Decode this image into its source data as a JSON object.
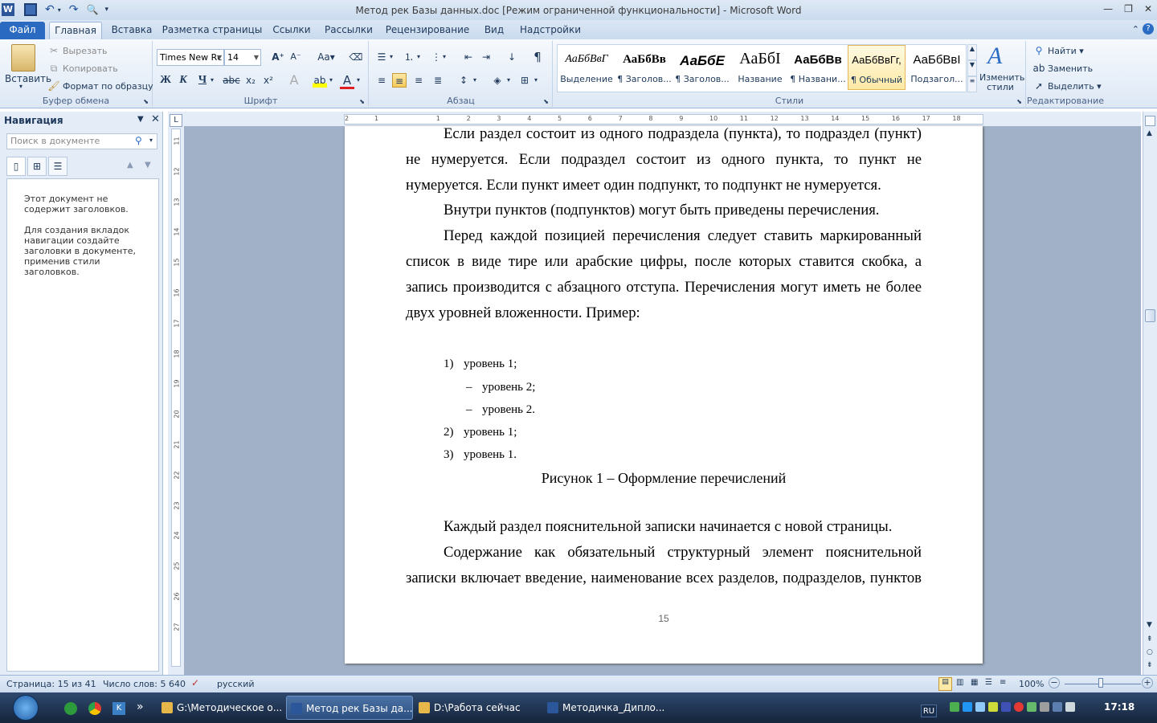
{
  "window": {
    "title": "Метод рек Базы данных.doc [Режим ограниченной функциональности]  -  Microsoft Word",
    "min": "—",
    "max": "❐",
    "close": "✕"
  },
  "tabs": [
    "Файл",
    "Главная",
    "Вставка",
    "Разметка страницы",
    "Ссылки",
    "Рассылки",
    "Рецензирование",
    "Вид",
    "Надстройки"
  ],
  "clipboard": {
    "paste": "Вставить",
    "cut": "Вырезать",
    "copy": "Копировать",
    "format_painter": "Формат по образцу",
    "label": "Буфер обмена"
  },
  "font": {
    "name": "Times New Rc",
    "size": "14",
    "label": "Шрифт",
    "case_btn": "Aa"
  },
  "paragraph": {
    "label": "Абзац"
  },
  "styles": {
    "label": "Стили",
    "items": [
      {
        "sample": "АаБбВвГ",
        "name": "Выделение"
      },
      {
        "sample": "АаБбВв",
        "name": "¶ Заголов..."
      },
      {
        "sample": "АаБбЕ",
        "name": "¶ Заголов..."
      },
      {
        "sample": "АаБбI",
        "name": "Название"
      },
      {
        "sample": "АаБбВв",
        "name": "¶ Названи..."
      },
      {
        "sample": "АаБбВвГг,",
        "name": "¶ Обычный"
      },
      {
        "sample": "АаБбВвI",
        "name": "Подзагол..."
      }
    ],
    "change": "Изменить стили"
  },
  "editing": {
    "find": "Найти",
    "replace": "Заменить",
    "select": "Выделить",
    "label": "Редактирование"
  },
  "nav": {
    "title": "Навигация",
    "search_placeholder": "Поиск в документе",
    "msg1": "Этот документ не содержит заголовков.",
    "msg2": "Для создания вкладок навигации создайте заголовки в документе, применив стили заголовков."
  },
  "ruler_numbers": [
    "2",
    "1",
    "1",
    "2",
    "3",
    "4",
    "5",
    "6",
    "7",
    "8",
    "9",
    "10",
    "11",
    "12",
    "13",
    "14",
    "15",
    "16",
    "17",
    "18"
  ],
  "vruler_numbers": [
    "11",
    "12",
    "13",
    "14",
    "15",
    "16",
    "17",
    "18",
    "19",
    "20",
    "21",
    "22",
    "23",
    "24",
    "25",
    "26",
    "27"
  ],
  "document": {
    "p1": "Если раздел состоит из одного подраздела (пункта), то подраздел (пункт) не нумеруется. Если подраздел состоит из одного пункта, то пункт не нумеруется. Если пункт имеет один подпункт, то подпункт не нумеруется.",
    "p2": "Внутри пунктов (подпунктов) могут быть приведены перечисления.",
    "p3": "Перед каждой позицией перечисления следует ставить маркированный список в виде  тире или арабские цифры, после которых ставится скобка, а запись производится с абзацного отступа. Перечисления могут иметь не более двух уровней вложенности. Пример:",
    "list": [
      {
        "marker": "1)",
        "text": "уровень 1;"
      },
      {
        "marker": "–",
        "text": "уровень 2;"
      },
      {
        "marker": "–",
        "text": "уровень 2."
      },
      {
        "marker": "2)",
        "text": "уровень 1;"
      },
      {
        "marker": "3)",
        "text": "уровень 1."
      }
    ],
    "caption": "Рисунок 1 – Оформление перечислений",
    "p4": "Каждый раздел пояснительной записки начинается с новой страницы.",
    "p5": "Содержание как обязательный структурный элемент пояснительной записки включает введение, наименование всех разделов, подразделов, пунктов (если они",
    "page_number": "15"
  },
  "status": {
    "page": "Страница: 15 из 41",
    "words": "Число слов: 5 640",
    "lang": "русский",
    "zoom": "100%"
  },
  "taskbar": {
    "items": [
      {
        "label": "G:\\Методическое о..."
      },
      {
        "label": "Метод рек Базы да..."
      },
      {
        "label": "D:\\Работа сейчас"
      },
      {
        "label": "Методичка_Дипло..."
      }
    ],
    "lang": "RU",
    "time": "17:18"
  }
}
